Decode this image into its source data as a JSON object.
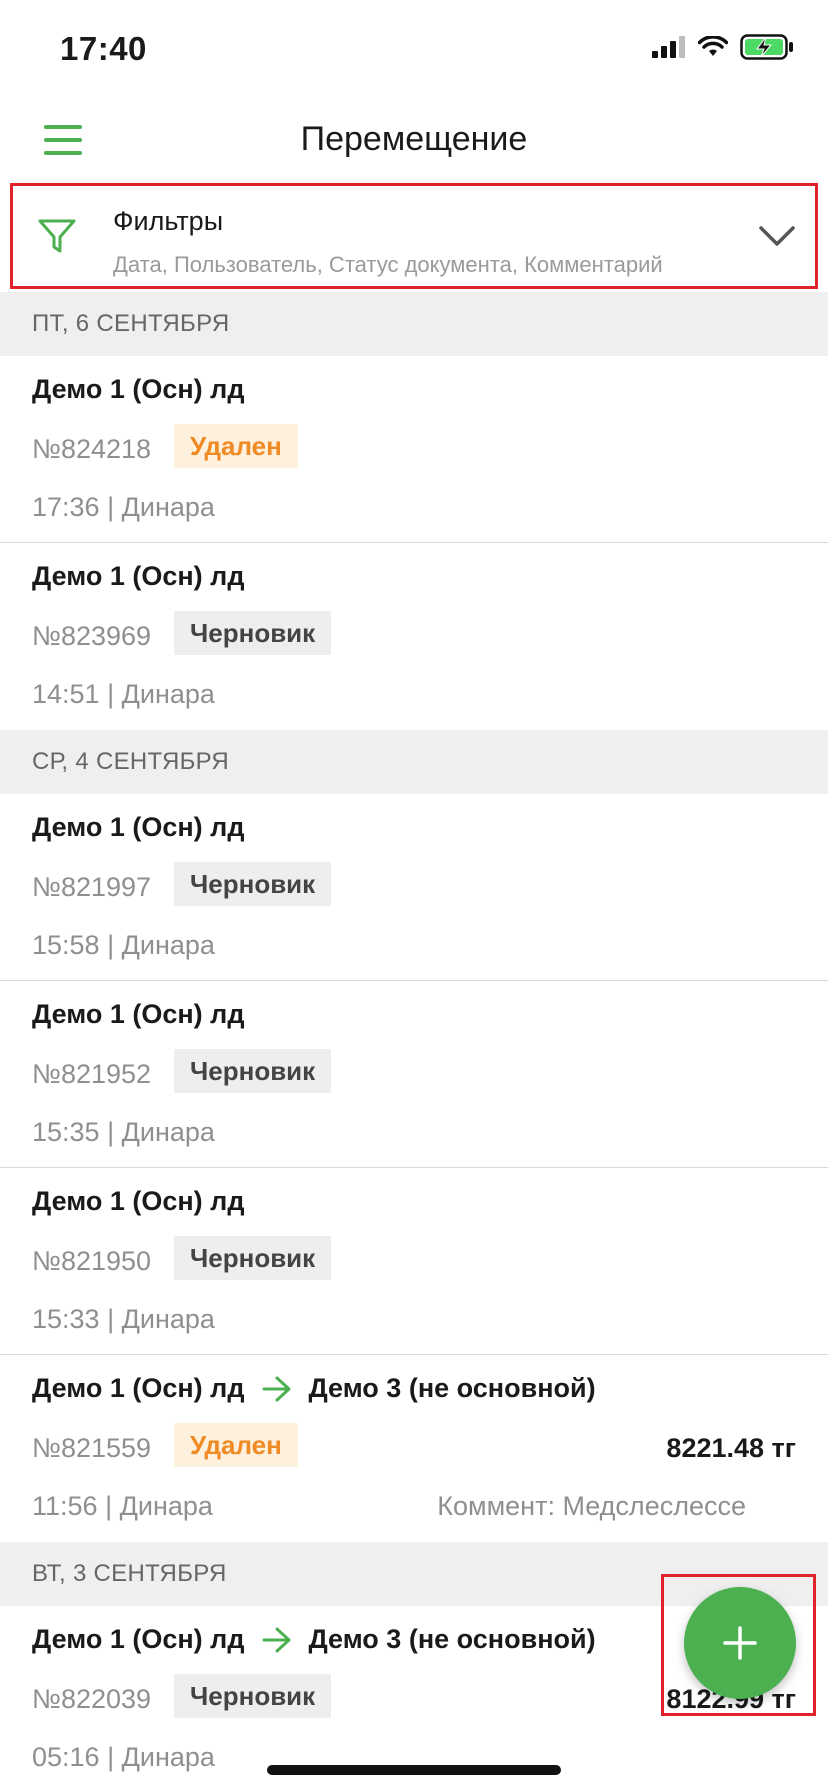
{
  "status_bar": {
    "time": "17:40"
  },
  "nav": {
    "title": "Перемещение"
  },
  "filter": {
    "title": "Фильтры",
    "summary": "Дата, Пользователь, Статус документа, Комментарий"
  },
  "sections": [
    {
      "header": "ПТ, 6 СЕНТЯБРЯ",
      "docs": [
        {
          "from": "Демо 1 (Осн) лд",
          "to": "",
          "number": "№824218",
          "status": "Удален",
          "status_type": "deleted",
          "amount": "",
          "meta": "17:36 | Динара",
          "comment": ""
        },
        {
          "from": "Демо 1 (Осн) лд",
          "to": "",
          "number": "№823969",
          "status": "Черновик",
          "status_type": "draft",
          "amount": "",
          "meta": "14:51 | Динара",
          "comment": ""
        }
      ]
    },
    {
      "header": "СР, 4 СЕНТЯБРЯ",
      "docs": [
        {
          "from": "Демо 1 (Осн) лд",
          "to": "",
          "number": "№821997",
          "status": "Черновик",
          "status_type": "draft",
          "amount": "",
          "meta": "15:58 | Динара",
          "comment": ""
        },
        {
          "from": "Демо 1 (Осн) лд",
          "to": "",
          "number": "№821952",
          "status": "Черновик",
          "status_type": "draft",
          "amount": "",
          "meta": "15:35 | Динара",
          "comment": ""
        },
        {
          "from": "Демо 1 (Осн) лд",
          "to": "",
          "number": "№821950",
          "status": "Черновик",
          "status_type": "draft",
          "amount": "",
          "meta": "15:33 | Динара",
          "comment": ""
        },
        {
          "from": "Демо 1 (Осн) лд",
          "to": "Демо 3 (не основной)",
          "number": "№821559",
          "status": "Удален",
          "status_type": "deleted",
          "amount": "8221.48 тг",
          "meta": "11:56 | Динара",
          "comment": "Коммент: Медслеслессе"
        }
      ]
    },
    {
      "header": "ВТ, 3 СЕНТЯБРЯ",
      "docs": [
        {
          "from": "Демо 1 (Осн) лд",
          "to": "Демо 3 (не основной)",
          "number": "№822039",
          "status": "Черновик",
          "status_type": "draft",
          "amount": "8122.99 тг",
          "meta": "05:16 | Динара",
          "comment": ""
        }
      ]
    }
  ],
  "icons": {
    "menu": "hamburger-icon",
    "filter": "filter-funnel-icon",
    "chevron": "chevron-down-icon",
    "arrow": "arrow-right-icon",
    "add": "plus-icon"
  },
  "colors": {
    "accent": "#4caf50",
    "highlight": "#e0222a",
    "deleted_text": "#f08a24",
    "deleted_bg": "#fdf0dc",
    "draft_bg": "#eeeeee",
    "section_bg": "#efefef"
  }
}
